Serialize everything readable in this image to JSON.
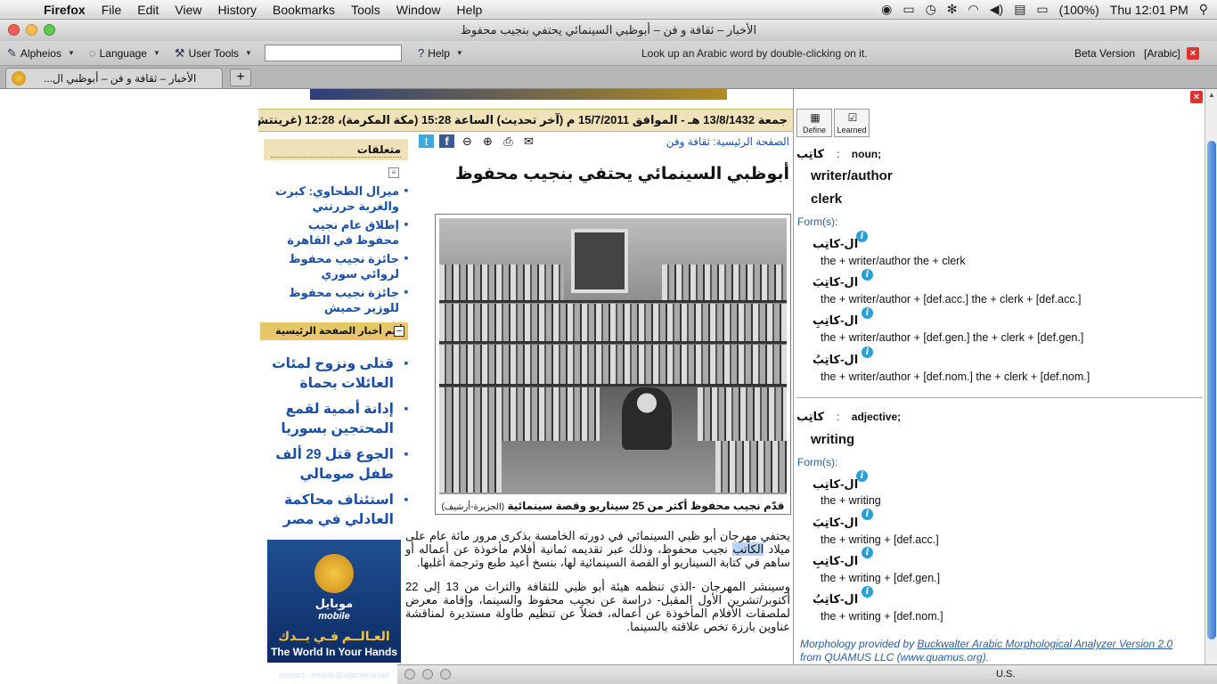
{
  "menubar": {
    "items": [
      "Firefox",
      "File",
      "Edit",
      "View",
      "History",
      "Bookmarks",
      "Tools",
      "Window",
      "Help"
    ],
    "battery": "(100%)",
    "clock": "Thu 12:01 PM"
  },
  "window": {
    "title": "الأخبار – ثقافة و فن – أبوظبي السينمائي يحتفي بنجيب محفوظ"
  },
  "toolbar": {
    "alpheios": "Alpheios",
    "language": "Language",
    "user_tools": "User Tools",
    "search_value": "",
    "help": "Help",
    "lookup_hint": "Look up an  Arabic word by double-clicking on it.",
    "beta": "Beta Version",
    "lang_tag": "[Arabic]"
  },
  "tabs": [
    {
      "label": "الأخبار – ثقافة و فن – أبوظبي ال..."
    }
  ],
  "page": {
    "datebar": "جمعة 13/8/1432 هـ - الموافق 15/7/2011 م (آخر تحديث) الساعة 15:28 (مكة المكرمة)، 12:28 (غرينتش)",
    "breadcrumb": "الصفحة الرئيسية: ثقافة وفن",
    "headline": "أبوظبي السينمائي يحتفي بنجيب محفوظ",
    "caption": "قدّم نجيب محفوظ أكثر من 25 سيناريو وقصة سينمائية",
    "caption_source": "(الجزيرة-أرشيف)",
    "para1_a": "يحتفي مهرجان أبو ظبي السينمائي في دورته الخامسة بذكرى مرور مائة عام على ميلاد ",
    "para1_hl": "الكاتب",
    "para1_b": " نجيب محفوظ، وذلك عبر تقديمه ثمانية أفلام مأخوذة عن أعماله أو ساهم في كتابة السيناريو أو القصة السينمائية لها، بنسخ أعيد طبع وترجمة أغلبها.",
    "para2": "وسينشر المهرجان -الذي تنظمه هيئة أبو ظبي للثقافة والتراث من 13 إلى 22 أكتوبر/تشرين الأول المقبل- دراسة عن نجيب محفوظ والسينما، وإقامة معرض لملصقات الأفلام المأخوذة عن أعماله، فضلاً عن تنظيم طاولة مستديرة لمناقشة عناوين بارزة تخص علاقته بالسينما."
  },
  "sidebar": {
    "related_title": "متعلقات",
    "related": [
      "ميرال الطحاوي: كبرت والغربة حررتني",
      "إطلاق عام نجيب محفوظ في القاهرة",
      "جائزة نجيب محفوظ لروائي سوري",
      "جائزة نجيب محفوظ للوزير حميش"
    ],
    "top_title": "أهم أخبار الصفحة الرئيسية",
    "top_news": [
      "قتلى ونزوح لمئات العائلات بحماة",
      "إدانة أممية لقمع المحتجين  بسوريا",
      "الجوع قتل 29 ألف طفل صومالي",
      "استئناف محاكمة العادلي في مصر"
    ],
    "ad": {
      "mobile_ar": "موبايل",
      "mobile": "mobile",
      "world_ar": "العـالــم فـي يــدك",
      "world": "The World In Your Hands",
      "contact": "contact : mobile@aljazeera.net"
    }
  },
  "panel": {
    "define": "Define",
    "learned": "Learned",
    "entry1": {
      "lemma": "كاتِب",
      "pos": "noun;",
      "meanings": [
        "writer/author",
        "clerk"
      ],
      "forms_label": "Form(s):",
      "forms": [
        {
          "ar": "ال-كاتِب",
          "en": "the + writer/author  the + clerk"
        },
        {
          "ar": "ال-كاتِبَ",
          "en": "the + writer/author + [def.acc.]  the + clerk + [def.acc.]"
        },
        {
          "ar": "ال-كاتِبِ",
          "en": "the + writer/author + [def.gen.]  the + clerk + [def.gen.]"
        },
        {
          "ar": "ال-كاتِبُ",
          "en": "the + writer/author + [def.nom.]  the + clerk + [def.nom.]"
        }
      ]
    },
    "entry2": {
      "lemma": "كاتِب",
      "pos": "adjective;",
      "meanings": [
        "writing"
      ],
      "forms_label": "Form(s):",
      "forms": [
        {
          "ar": "ال-كاتِب",
          "en": "the + writing"
        },
        {
          "ar": "ال-كاتِبَ",
          "en": "the + writing + [def.acc.]"
        },
        {
          "ar": "ال-كاتِبِ",
          "en": "the + writing + [def.gen.]"
        },
        {
          "ar": "ال-كاتِبُ",
          "en": "the + writing + [def.nom.]"
        }
      ]
    },
    "credit_a": "Morphology provided by ",
    "credit_link": "Buckwalter Arabic Morphological Analyzer Version 2.0",
    "credit_b": " from QUAMUS LLC (www.quamus.org)."
  },
  "bottombar": {
    "input_source": "U.S."
  },
  "colors": {
    "link": "#1b4fa6",
    "highlight": "#b7d3f5",
    "datebar_bg": "#efe1b8"
  }
}
